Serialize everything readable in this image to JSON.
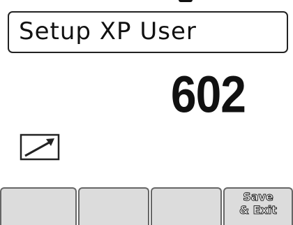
{
  "screen": {
    "title": "Setup XP User",
    "value": "602"
  },
  "icons": {
    "trend": "trend-arrow-up-right-icon"
  },
  "softkeys": [
    {
      "label": ""
    },
    {
      "label": ""
    },
    {
      "label": ""
    },
    {
      "label": "Save\n& Exit"
    }
  ],
  "colors": {
    "background": "#ffffff",
    "text": "#111111",
    "softkey_bg": "#dcdcdc",
    "softkey_border": "#666666"
  }
}
